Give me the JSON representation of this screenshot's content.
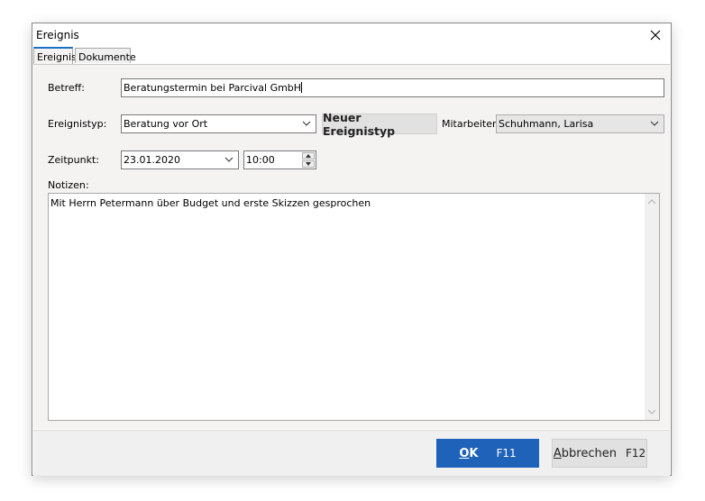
{
  "window": {
    "title": "Ereignis"
  },
  "tabs": [
    {
      "label": "Ereignis",
      "active": true
    },
    {
      "label": "Dokumente",
      "active": false
    }
  ],
  "form": {
    "subject_label": "Betreff:",
    "subject_value": "Beratungstermin bei Parcival GmbH",
    "event_type_label": "Ereignistyp:",
    "event_type_value": "Beratung vor Ort",
    "new_event_type_label": "Neuer Ereignistyp",
    "employee_label": "Mitarbeiter:",
    "employee_value": "Schuhmann, Larisa",
    "time_label": "Zeitpunkt:",
    "date_value": "23.01.2020",
    "time_value": "10:00",
    "notes_label": "Notizen:",
    "notes_value": "Mit Herrn Petermann über Budget und erste Skizzen gesprochen"
  },
  "footer": {
    "ok_label": "OK",
    "ok_key": "F11",
    "cancel_label": "Abbrechen",
    "cancel_key": "F12"
  },
  "colors": {
    "accent": "#1e63b9",
    "tab_highlight": "#1c6fc7",
    "panel_bg": "#f4f3f2"
  }
}
